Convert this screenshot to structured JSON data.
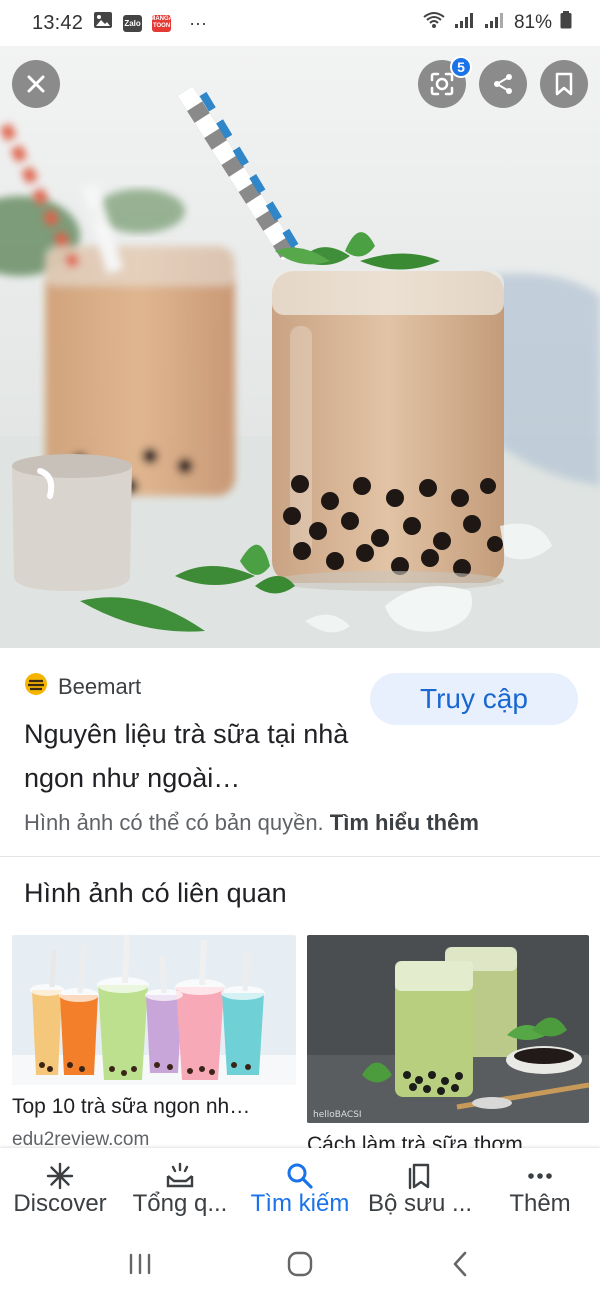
{
  "status_bar": {
    "time": "13:42",
    "notifications": [
      "gallery-icon",
      "Zalo",
      "MANGA TOON"
    ],
    "more": "···",
    "battery": "81%"
  },
  "hero": {
    "lens_badge": "5"
  },
  "result": {
    "source": "Beemart",
    "visit_label": "Truy cập",
    "title": "Nguyên liệu trà sữa tại nhà ngon như ngoài…",
    "copyright_text": "Hình ảnh có thể có bản quyền.",
    "learn_more": "Tìm hiểu thêm"
  },
  "related": {
    "heading": "Hình ảnh có liên quan",
    "items": [
      {
        "title": "Top 10 trà sữa ngon nh…",
        "site": "edu2review.com"
      },
      {
        "title": "Cách làm trà sữa thơm…",
        "site": ""
      }
    ]
  },
  "bottom_nav": [
    {
      "label": "Discover",
      "icon": "asterisk-icon"
    },
    {
      "label": "Tổng q...",
      "icon": "updates-icon"
    },
    {
      "label": "Tìm kiếm",
      "icon": "search-icon",
      "active": true
    },
    {
      "label": "Bộ sưu ...",
      "icon": "collections-icon"
    },
    {
      "label": "Thêm",
      "icon": "more-icon"
    }
  ],
  "colors": {
    "accent": "#1a73e8",
    "visit_bg": "#e8f0fe",
    "text": "#202124",
    "secondary_text": "#5f6368"
  }
}
